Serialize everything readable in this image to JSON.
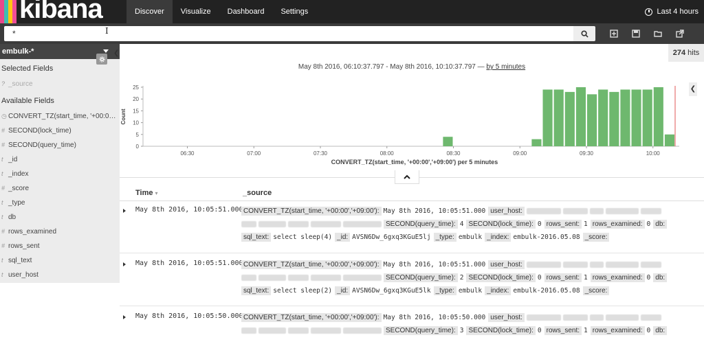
{
  "app": {
    "logo_text": "kibana",
    "brand_colors": [
      "#e8488b",
      "#3ebeb0",
      "#fec514",
      "#f04e98"
    ]
  },
  "nav": {
    "items": [
      {
        "label": "Discover",
        "active": true
      },
      {
        "label": "Visualize",
        "active": false
      },
      {
        "label": "Dashboard",
        "active": false
      },
      {
        "label": "Settings",
        "active": false
      }
    ]
  },
  "time_picker": {
    "label": "Last 4 hours",
    "icon": "clock-icon"
  },
  "search": {
    "value": "*",
    "icons": [
      "search-icon",
      "new-search-icon",
      "save-icon",
      "open-icon",
      "share-icon"
    ]
  },
  "sidebar": {
    "index_pattern": "embulk-*",
    "selected_title": "Selected Fields",
    "selected_fields": [
      {
        "type": "?",
        "name": "_source"
      }
    ],
    "available_title": "Available Fields",
    "available_fields": [
      {
        "type": "◷",
        "name": "CONVERT_TZ(start_time, '+00:00'..."
      },
      {
        "type": "#",
        "name": "SECOND(lock_time)"
      },
      {
        "type": "#",
        "name": "SECOND(query_time)"
      },
      {
        "type": "t",
        "name": "_id"
      },
      {
        "type": "t",
        "name": "_index"
      },
      {
        "type": "#",
        "name": "_score"
      },
      {
        "type": "t",
        "name": "_type"
      },
      {
        "type": "t",
        "name": "db"
      },
      {
        "type": "#",
        "name": "rows_examined"
      },
      {
        "type": "#",
        "name": "rows_sent"
      },
      {
        "type": "t",
        "name": "sql_text"
      },
      {
        "type": "t",
        "name": "user_host"
      }
    ]
  },
  "hits": {
    "count": "274",
    "label": "hits"
  },
  "time_range": {
    "text": "May 8th 2016, 06:10:37.797 - May 8th 2016, 10:10:37.797 —",
    "interval": "by 5 minutes"
  },
  "chart_data": {
    "type": "bar",
    "color": "#6eb86e",
    "ylabel": "Count",
    "xlabel": "CONVERT_TZ(start_time, '+00:00','+09:00') per 5 minutes",
    "ylim": [
      0,
      25
    ],
    "yticks": [
      0,
      5,
      10,
      15,
      20,
      25
    ],
    "x_ticks": [
      "06:30",
      "07:00",
      "07:30",
      "08:00",
      "08:30",
      "09:00",
      "09:30",
      "10:00"
    ],
    "x_tick_minutes": [
      390,
      420,
      450,
      480,
      510,
      540,
      570,
      600
    ],
    "x_range_minutes": [
      370,
      610
    ],
    "bars": [
      {
        "start": 505,
        "value": 4
      },
      {
        "start": 545,
        "value": 3
      },
      {
        "start": 550,
        "value": 24
      },
      {
        "start": 555,
        "value": 24
      },
      {
        "start": 560,
        "value": 23
      },
      {
        "start": 565,
        "value": 25
      },
      {
        "start": 570,
        "value": 22
      },
      {
        "start": 575,
        "value": 24
      },
      {
        "start": 580,
        "value": 23
      },
      {
        "start": 585,
        "value": 24
      },
      {
        "start": 590,
        "value": 24
      },
      {
        "start": 595,
        "value": 24
      },
      {
        "start": 600,
        "value": 25
      },
      {
        "start": 605,
        "value": 5
      }
    ],
    "now_marker_minute": 610
  },
  "table": {
    "col_time": "Time",
    "col_source": "_source",
    "rows": [
      {
        "time": "May 8th 2016, 10:05:51.000",
        "convert_tz_key": "CONVERT_TZ(start_time, '+00:00','+09:00'):",
        "convert_tz_val": "May 8th 2016, 10:05:51.000",
        "user_host_key": "user_host:",
        "query_time_key": "SECOND(query_time):",
        "query_time_val": "4",
        "lock_time_key": "SECOND(lock_time):",
        "lock_time_val": "0",
        "rows_sent_key": "rows_sent:",
        "rows_sent_val": "1",
        "rows_examined_key": "rows_examined:",
        "rows_examined_val": "0",
        "db_key": "db:",
        "sql_text_key": "sql_text:",
        "sql_text_val": "select sleep(4)",
        "id_key": "_id:",
        "id_val": "AVSN6Dw_6gxq3KGuE5lj",
        "type_key": "_type:",
        "type_val": "embulk",
        "index_key": "_index:",
        "index_val": "embulk-2016.05.08",
        "score_key": "_score:"
      },
      {
        "time": "May 8th 2016, 10:05:51.000",
        "convert_tz_key": "CONVERT_TZ(start_time, '+00:00','+09:00'):",
        "convert_tz_val": "May 8th 2016, 10:05:51.000",
        "user_host_key": "user_host:",
        "query_time_key": "SECOND(query_time):",
        "query_time_val": "2",
        "lock_time_key": "SECOND(lock_time):",
        "lock_time_val": "0",
        "rows_sent_key": "rows_sent:",
        "rows_sent_val": "1",
        "rows_examined_key": "rows_examined:",
        "rows_examined_val": "0",
        "db_key": "db:",
        "sql_text_key": "sql_text:",
        "sql_text_val": "select sleep(2)",
        "id_key": "_id:",
        "id_val": "AVSN6Dw_6gxq3KGuE5lk",
        "type_key": "_type:",
        "type_val": "embulk",
        "index_key": "_index:",
        "index_val": "embulk-2016.05.08",
        "score_key": "_score:"
      },
      {
        "time": "May 8th 2016, 10:05:50.000",
        "convert_tz_key": "CONVERT_TZ(start_time, '+00:00','+09:00'):",
        "convert_tz_val": "May 8th 2016, 10:05:50.000",
        "user_host_key": "user_host:",
        "query_time_key": "SECOND(query_time):",
        "query_time_val": "3",
        "lock_time_key": "SECOND(lock_time):",
        "lock_time_val": "0",
        "rows_sent_key": "rows_sent:",
        "rows_sent_val": "1",
        "rows_examined_key": "rows_examined:",
        "rows_examined_val": "0",
        "db_key": "db:"
      }
    ]
  }
}
